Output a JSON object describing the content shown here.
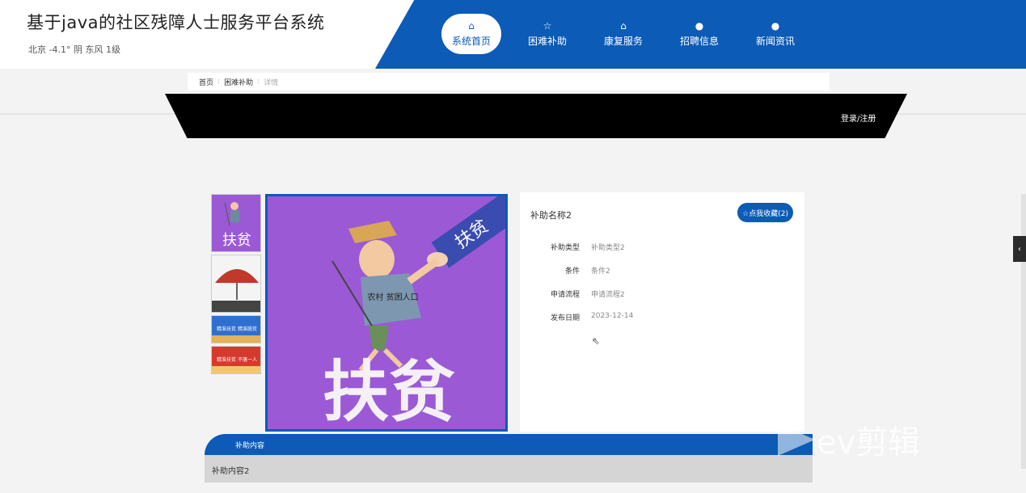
{
  "header": {
    "site_title": "基于java的社区残障人士服务平台系统",
    "weather": "北京 -4.1° 阴 东风 1级"
  },
  "nav": [
    {
      "icon": "home-icon",
      "glyph": "⌂",
      "label": "系统首页"
    },
    {
      "icon": "star-icon",
      "glyph": "☆",
      "label": "困难补助"
    },
    {
      "icon": "bag-icon",
      "glyph": "⌂",
      "label": "康复服务"
    },
    {
      "icon": "info-icon",
      "glyph": "●",
      "label": "招聘信息"
    },
    {
      "icon": "help-icon",
      "glyph": "●",
      "label": "新闻资讯"
    }
  ],
  "breadcrumb": {
    "home": "首页",
    "section": "困难补助",
    "current": "详情"
  },
  "login_label": "登录/注册",
  "detail": {
    "name": "补助名称2",
    "fav_label": "☆点我收藏(2)",
    "rows": [
      {
        "key": "补助类型",
        "value": "补助类型2"
      },
      {
        "key": "条件",
        "value": "条件2"
      },
      {
        "key": "申请流程",
        "value": "申请流程2"
      },
      {
        "key": "发布日期",
        "value": "2023-12-14"
      }
    ]
  },
  "main_image": {
    "caption": "扶贫",
    "sign_text": "扶贫",
    "shirt_text": "农村 贫困人口"
  },
  "thumbnails": [
    {
      "caption": "扶贫"
    },
    {
      "caption": ""
    },
    {
      "caption": "精准扶贫 精准脱贫"
    },
    {
      "caption": "精准扶贫 不落一人"
    }
  ],
  "content": {
    "tab_label": "补助内容",
    "text": "补助内容2"
  },
  "watermark": "ev剪辑",
  "colors": {
    "brand_blue": "#0b5bb7",
    "image_purple": "#9b59d6"
  }
}
